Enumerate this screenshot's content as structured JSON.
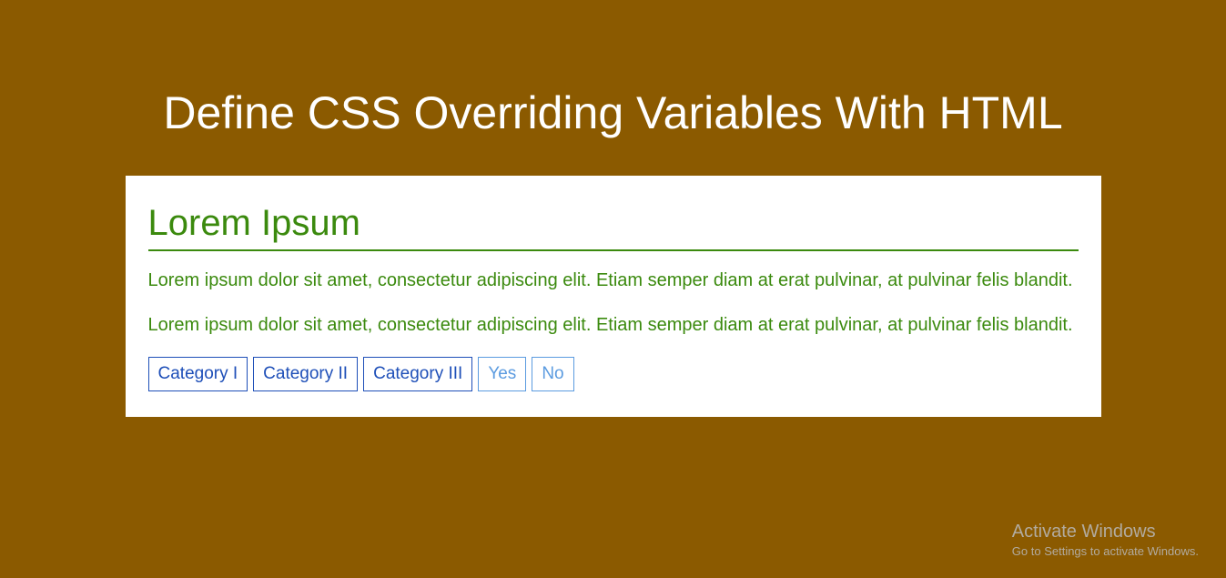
{
  "header": {
    "title": "Define CSS Overriding Variables With HTML"
  },
  "card": {
    "heading": "Lorem Ipsum",
    "paragraphs": [
      "Lorem ipsum dolor sit amet, consectetur adipiscing elit. Etiam semper diam at erat pulvinar, at pulvinar felis blandit.",
      "Lorem ipsum dolor sit amet, consectetur adipiscing elit. Etiam semper diam at erat pulvinar, at pulvinar felis blandit."
    ],
    "buttons": {
      "cat1": "Category I",
      "cat2": "Category II",
      "cat3": "Category III",
      "yes": "Yes",
      "no": "No"
    }
  },
  "watermark": {
    "title": "Activate Windows",
    "sub": "Go to Settings to activate Windows."
  }
}
